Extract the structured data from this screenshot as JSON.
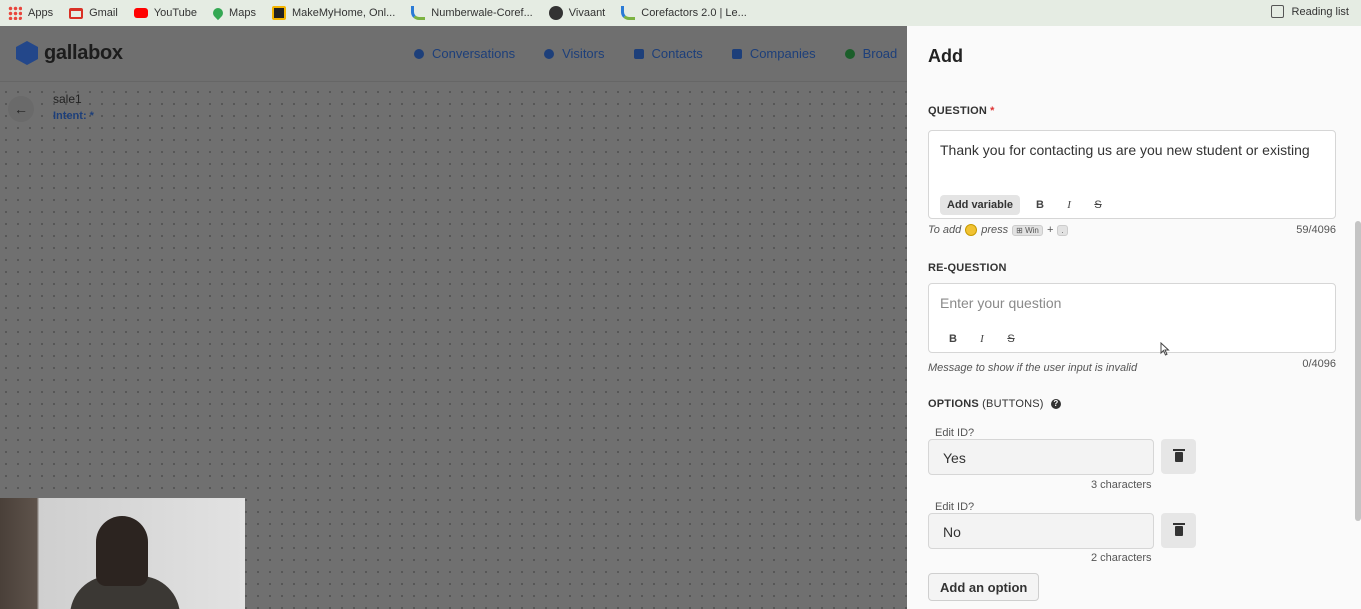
{
  "bookmarks": {
    "items": [
      {
        "label": "Apps",
        "icon": "apps-grid-icon",
        "color": "#e8453c"
      },
      {
        "label": "Gmail",
        "icon": "gmail-icon",
        "color": "#d93025"
      },
      {
        "label": "YouTube",
        "icon": "youtube-icon",
        "color": "#ff0000"
      },
      {
        "label": "Maps",
        "icon": "maps-pin-icon",
        "color": "#34a853"
      },
      {
        "label": "MakeMyHome, Onl...",
        "icon": "makemyhome-icon",
        "color": "#222222"
      },
      {
        "label": "Numberwale-Coref...",
        "icon": "corefactors-icon",
        "color": "#2b7bd6"
      },
      {
        "label": "Vivaant",
        "icon": "globe-icon",
        "color": "#333333"
      },
      {
        "label": "Corefactors 2.0 | Le...",
        "icon": "corefactors-icon",
        "color": "#2b7bd6"
      }
    ],
    "reading_list": "Reading list"
  },
  "app": {
    "logo": "gallabox",
    "nav": [
      {
        "label": "Conversations",
        "icon": "chat-icon"
      },
      {
        "label": "Visitors",
        "icon": "user-icon"
      },
      {
        "label": "Contacts",
        "icon": "contact-book-icon"
      },
      {
        "label": "Companies",
        "icon": "building-icon"
      },
      {
        "label": "Broad",
        "icon": "whatsapp-icon"
      }
    ],
    "flow": {
      "title": "sale1",
      "intent": "Intent: *"
    }
  },
  "panel": {
    "title": "Add",
    "question": {
      "label": "QUESTION",
      "required_mark": "*",
      "value": "Thank you for contacting us are you new student or existing",
      "add_variable": "Add variable",
      "bold": "B",
      "italic": "I",
      "strike": "S",
      "hint_prefix": "To add",
      "hint_press": "press",
      "hint_key": "⊞ Win",
      "hint_plus": "+",
      "hint_key2": ".",
      "count": "59/4096"
    },
    "requestion": {
      "label": "RE-QUESTION",
      "placeholder": "Enter your question",
      "bold": "B",
      "italic": "I",
      "strike": "S",
      "hint": "Message to show if the user input is invalid",
      "count": "0/4096"
    },
    "options": {
      "label": "OPTIONS",
      "sublabel": "(BUTTONS)",
      "help": "?",
      "items": [
        {
          "edit_id": "Edit ID?",
          "value": "Yes",
          "chars": "3 characters"
        },
        {
          "edit_id": "Edit ID?",
          "value": "No",
          "chars": "2 characters"
        }
      ],
      "add_option": "Add an option"
    }
  }
}
